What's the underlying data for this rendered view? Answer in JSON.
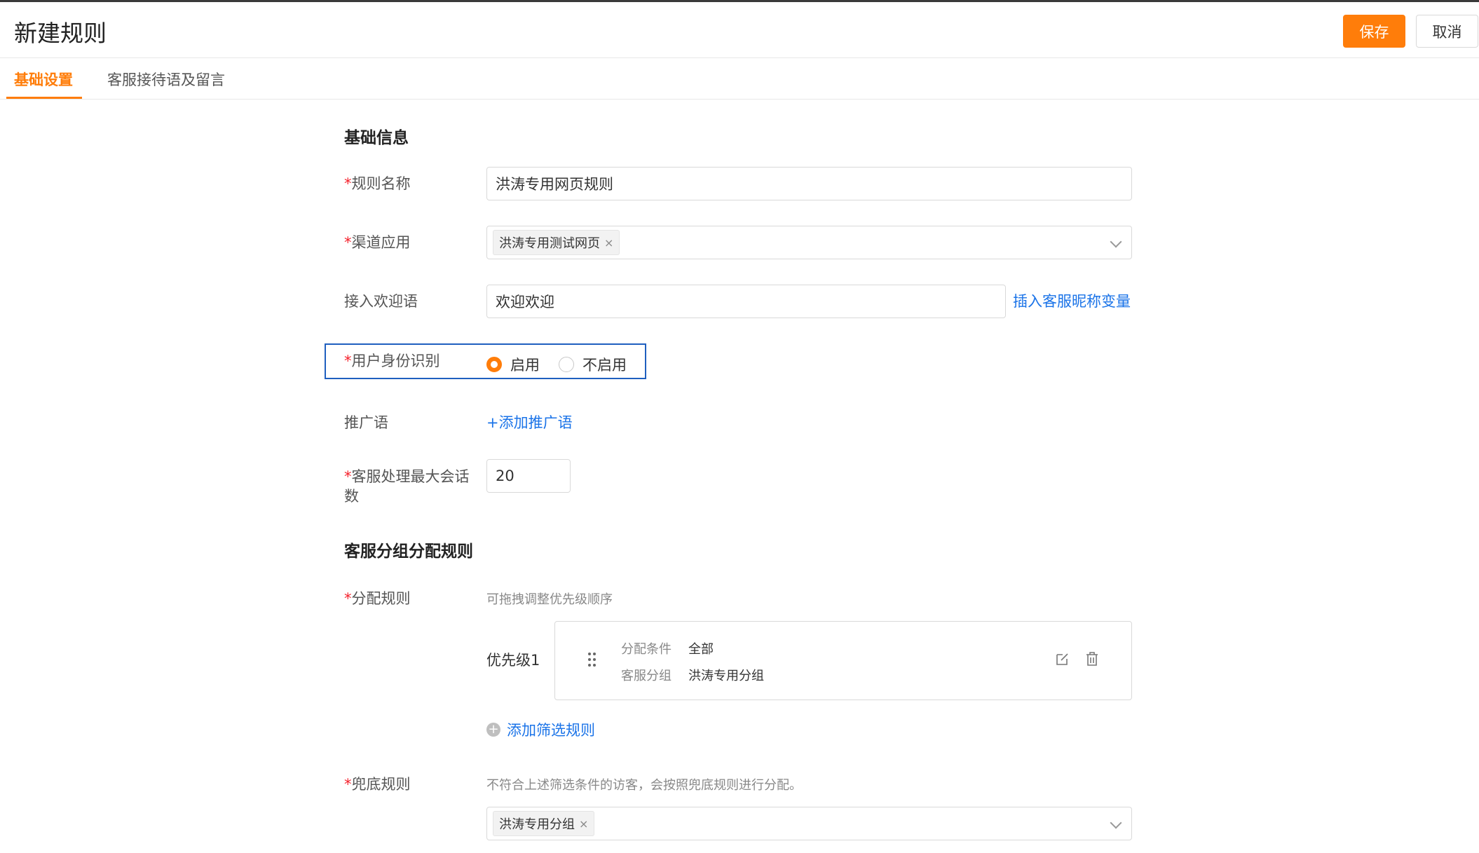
{
  "header": {
    "title": "新建规则",
    "save_label": "保存",
    "cancel_label": "取消"
  },
  "tabs": [
    {
      "label": "基础设置",
      "active": true
    },
    {
      "label": "客服接待语及留言",
      "active": false
    }
  ],
  "basic_info": {
    "section_title": "基础信息",
    "rule_name": {
      "label": "规则名称",
      "required": true,
      "value": "洪涛专用网页规则"
    },
    "channel_app": {
      "label": "渠道应用",
      "required": true,
      "tags": [
        "洪涛专用测试网页"
      ]
    },
    "welcome": {
      "label": "接入欢迎语",
      "required": false,
      "value": "欢迎欢迎",
      "insert_link": "插入客服昵称变量"
    },
    "identity": {
      "label": "用户身份识别",
      "required": true,
      "options": [
        "启用",
        "不启用"
      ],
      "selected": "启用"
    },
    "promo": {
      "label": "推广语",
      "required": false,
      "add_link": "+添加推广语"
    },
    "max_sessions": {
      "label_line1": "客服处理最大会话",
      "label_line2": "数",
      "required": true,
      "value": "20"
    }
  },
  "allocation": {
    "section_title": "客服分组分配规则",
    "rules": {
      "label": "分配规则",
      "required": true,
      "hint": "可拖拽调整优先级顺序",
      "items": [
        {
          "priority": "优先级1",
          "condition_key": "分配条件",
          "condition_value": "全部",
          "group_key": "客服分组",
          "group_value": "洪涛专用分组"
        }
      ],
      "add_link": "添加筛选规则"
    },
    "fallback": {
      "label": "兜底规则",
      "required": true,
      "hint": "不符合上述筛选条件的访客，会按照兜底规则进行分配。",
      "tags": [
        "洪涛专用分组"
      ]
    }
  },
  "colors": {
    "accent": "#ff7d0a",
    "link": "#1a73e8",
    "required": "#f5222d",
    "focus": "#1f5fbf"
  }
}
